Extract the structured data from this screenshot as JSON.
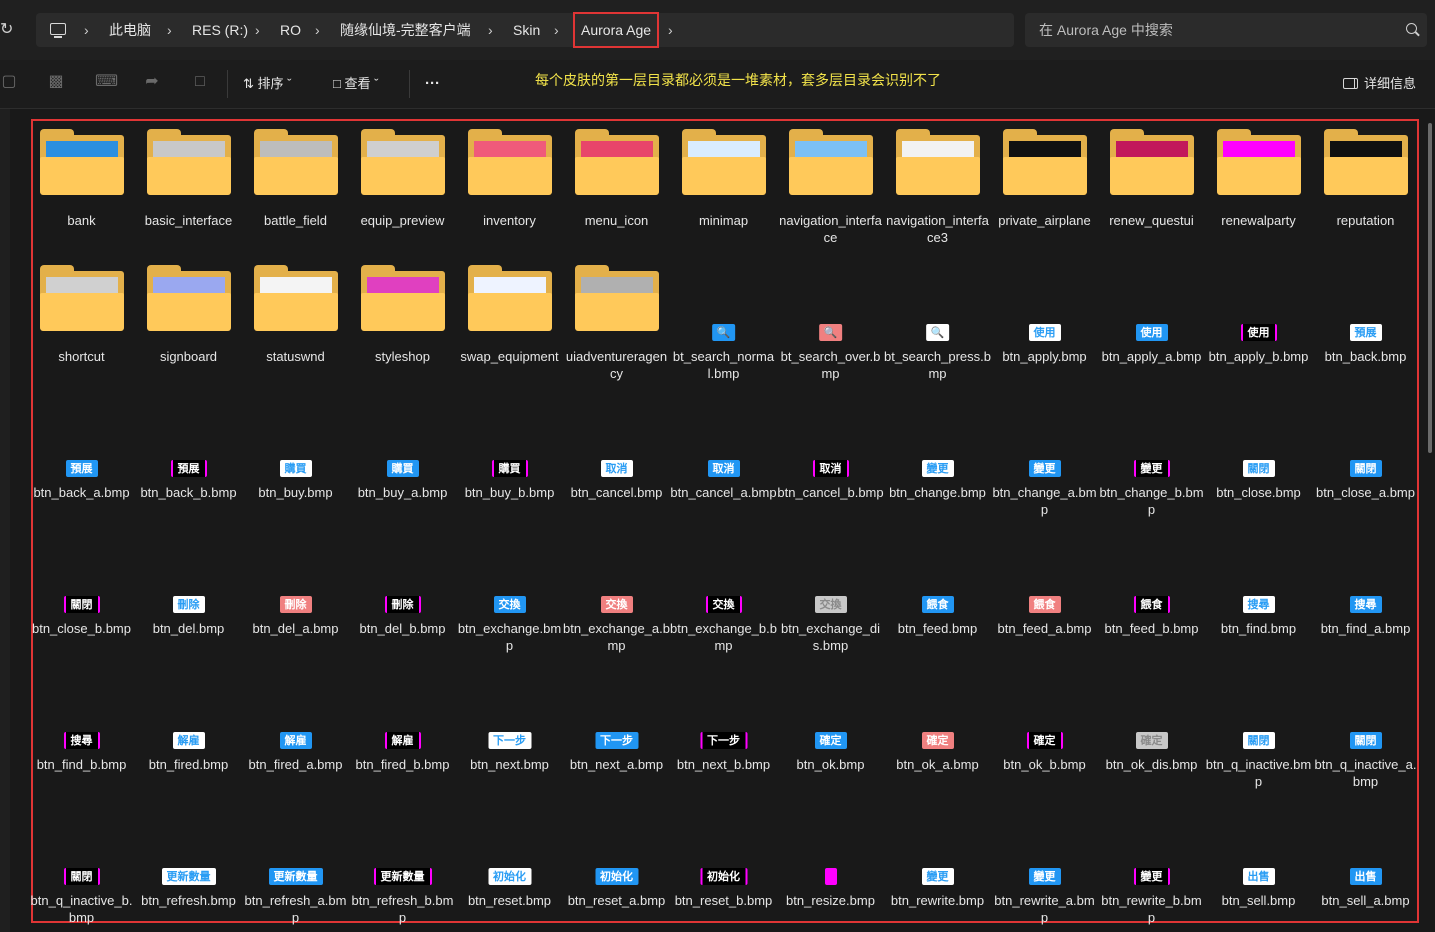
{
  "breadcrumb": {
    "items": [
      "此电脑",
      "RES (R:)",
      "RO",
      "随缘仙境-完整客户端",
      "Skin",
      "Aurora Age"
    ]
  },
  "search": {
    "placeholder": "在 Aurora Age 中搜索"
  },
  "toolbar": {
    "sort_label": "排序",
    "view_label": "查看",
    "more_label": "···",
    "notice": "每个皮肤的第一层目录都必须是一堆素材，套多层目录会识别不了",
    "details_label": "详细信息"
  },
  "files": [
    {
      "name": "bank",
      "type": "folder",
      "preview": "#2b8fe0"
    },
    {
      "name": "basic_interface",
      "type": "folder",
      "preview": "#c8c8c8"
    },
    {
      "name": "battle_field",
      "type": "folder",
      "preview": "#bdbdbd"
    },
    {
      "name": "equip_preview",
      "type": "folder",
      "preview": "#cfcfcf"
    },
    {
      "name": "inventory",
      "type": "folder",
      "preview": "#f05a7a"
    },
    {
      "name": "menu_icon",
      "type": "folder",
      "preview": "#e8456a"
    },
    {
      "name": "minimap",
      "type": "folder",
      "preview": "#d9ecff"
    },
    {
      "name": "navigation_interface",
      "type": "folder",
      "preview": "#7cc0f5"
    },
    {
      "name": "navigation_interface3",
      "type": "folder",
      "preview": "#f2f2f2"
    },
    {
      "name": "private_airplane",
      "type": "folder",
      "preview": "#111111"
    },
    {
      "name": "renew_questui",
      "type": "folder",
      "preview": "#c2185b"
    },
    {
      "name": "renewalparty",
      "type": "folder",
      "preview": "#ff00ff"
    },
    {
      "name": "reputation",
      "type": "folder",
      "preview": "#101010"
    },
    {
      "name": "shortcut",
      "type": "folder",
      "preview": "#d0d0d0"
    },
    {
      "name": "signboard",
      "type": "folder",
      "preview": "#9aa8f0"
    },
    {
      "name": "statuswnd",
      "type": "folder",
      "preview": "#f4f4f4"
    },
    {
      "name": "styleshop",
      "type": "folder",
      "preview": "#e040c0"
    },
    {
      "name": "swap_equipment",
      "type": "folder",
      "preview": "#eef3ff"
    },
    {
      "name": "uiadventureragency",
      "type": "folder",
      "preview": "#b0b0b0"
    },
    {
      "name": "bt_search_normal.bmp",
      "type": "bmp",
      "thumb": "🔍",
      "style": "st-a"
    },
    {
      "name": "bt_search_over.bmp",
      "type": "bmp",
      "thumb": "🔍",
      "style": "st-over"
    },
    {
      "name": "bt_search_press.bmp",
      "type": "bmp",
      "thumb": "🔍",
      "style": "st-n"
    },
    {
      "name": "btn_apply.bmp",
      "type": "bmp",
      "thumb": "使用",
      "style": "st-n"
    },
    {
      "name": "btn_apply_a.bmp",
      "type": "bmp",
      "thumb": "使用",
      "style": "st-a"
    },
    {
      "name": "btn_apply_b.bmp",
      "type": "bmp",
      "thumb": "使用",
      "style": "st-b"
    },
    {
      "name": "btn_back.bmp",
      "type": "bmp",
      "thumb": "預展",
      "style": "st-n"
    },
    {
      "name": "btn_back_a.bmp",
      "type": "bmp",
      "thumb": "預展",
      "style": "st-a"
    },
    {
      "name": "btn_back_b.bmp",
      "type": "bmp",
      "thumb": "預展",
      "style": "st-b"
    },
    {
      "name": "btn_buy.bmp",
      "type": "bmp",
      "thumb": "購買",
      "style": "st-n"
    },
    {
      "name": "btn_buy_a.bmp",
      "type": "bmp",
      "thumb": "購買",
      "style": "st-a"
    },
    {
      "name": "btn_buy_b.bmp",
      "type": "bmp",
      "thumb": "購買",
      "style": "st-b"
    },
    {
      "name": "btn_cancel.bmp",
      "type": "bmp",
      "thumb": "取消",
      "style": "st-n"
    },
    {
      "name": "btn_cancel_a.bmp",
      "type": "bmp",
      "thumb": "取消",
      "style": "st-a"
    },
    {
      "name": "btn_cancel_b.bmp",
      "type": "bmp",
      "thumb": "取消",
      "style": "st-b"
    },
    {
      "name": "btn_change.bmp",
      "type": "bmp",
      "thumb": "變更",
      "style": "st-n"
    },
    {
      "name": "btn_change_a.bmp",
      "type": "bmp",
      "thumb": "變更",
      "style": "st-a"
    },
    {
      "name": "btn_change_b.bmp",
      "type": "bmp",
      "thumb": "變更",
      "style": "st-b"
    },
    {
      "name": "btn_close.bmp",
      "type": "bmp",
      "thumb": "關閉",
      "style": "st-n"
    },
    {
      "name": "btn_close_a.bmp",
      "type": "bmp",
      "thumb": "關閉",
      "style": "st-a"
    },
    {
      "name": "btn_close_b.bmp",
      "type": "bmp",
      "thumb": "關閉",
      "style": "st-b"
    },
    {
      "name": "btn_del.bmp",
      "type": "bmp",
      "thumb": "刪除",
      "style": "st-n"
    },
    {
      "name": "btn_del_a.bmp",
      "type": "bmp",
      "thumb": "刪除",
      "style": "st-over"
    },
    {
      "name": "btn_del_b.bmp",
      "type": "bmp",
      "thumb": "刪除",
      "style": "st-b"
    },
    {
      "name": "btn_exchange.bmp",
      "type": "bmp",
      "thumb": "交換",
      "style": "st-a"
    },
    {
      "name": "btn_exchange_a.bmp",
      "type": "bmp",
      "thumb": "交換",
      "style": "st-over"
    },
    {
      "name": "btn_exchange_b.bmp",
      "type": "bmp",
      "thumb": "交換",
      "style": "st-b"
    },
    {
      "name": "btn_exchange_dis.bmp",
      "type": "bmp",
      "thumb": "交換",
      "style": "st-dis"
    },
    {
      "name": "btn_feed.bmp",
      "type": "bmp",
      "thumb": "餵食",
      "style": "st-a"
    },
    {
      "name": "btn_feed_a.bmp",
      "type": "bmp",
      "thumb": "餵食",
      "style": "st-over"
    },
    {
      "name": "btn_feed_b.bmp",
      "type": "bmp",
      "thumb": "餵食",
      "style": "st-b"
    },
    {
      "name": "btn_find.bmp",
      "type": "bmp",
      "thumb": "搜尋",
      "style": "st-n"
    },
    {
      "name": "btn_find_a.bmp",
      "type": "bmp",
      "thumb": "搜尋",
      "style": "st-a"
    },
    {
      "name": "btn_find_b.bmp",
      "type": "bmp",
      "thumb": "搜尋",
      "style": "st-b"
    },
    {
      "name": "btn_fired.bmp",
      "type": "bmp",
      "thumb": "解雇",
      "style": "st-n"
    },
    {
      "name": "btn_fired_a.bmp",
      "type": "bmp",
      "thumb": "解雇",
      "style": "st-a"
    },
    {
      "name": "btn_fired_b.bmp",
      "type": "bmp",
      "thumb": "解雇",
      "style": "st-b"
    },
    {
      "name": "btn_next.bmp",
      "type": "bmp",
      "thumb": "下一步",
      "style": "st-n"
    },
    {
      "name": "btn_next_a.bmp",
      "type": "bmp",
      "thumb": "下一步",
      "style": "st-a"
    },
    {
      "name": "btn_next_b.bmp",
      "type": "bmp",
      "thumb": "下一步",
      "style": "st-b"
    },
    {
      "name": "btn_ok.bmp",
      "type": "bmp",
      "thumb": "確定",
      "style": "st-a"
    },
    {
      "name": "btn_ok_a.bmp",
      "type": "bmp",
      "thumb": "確定",
      "style": "st-over"
    },
    {
      "name": "btn_ok_b.bmp",
      "type": "bmp",
      "thumb": "確定",
      "style": "st-b"
    },
    {
      "name": "btn_ok_dis.bmp",
      "type": "bmp",
      "thumb": "確定",
      "style": "st-dis"
    },
    {
      "name": "btn_q_inactive.bmp",
      "type": "bmp",
      "thumb": "關閉",
      "style": "st-n"
    },
    {
      "name": "btn_q_inactive_a.bmp",
      "type": "bmp",
      "thumb": "關閉",
      "style": "st-a"
    },
    {
      "name": "btn_q_inactive_b.bmp",
      "type": "bmp",
      "thumb": "關閉",
      "style": "st-b"
    },
    {
      "name": "btn_refresh.bmp",
      "type": "bmp",
      "thumb": "更新數量",
      "style": "st-n"
    },
    {
      "name": "btn_refresh_a.bmp",
      "type": "bmp",
      "thumb": "更新數量",
      "style": "st-a"
    },
    {
      "name": "btn_refresh_b.bmp",
      "type": "bmp",
      "thumb": "更新數量",
      "style": "st-b"
    },
    {
      "name": "btn_reset.bmp",
      "type": "bmp",
      "thumb": "初始化",
      "style": "st-n"
    },
    {
      "name": "btn_reset_a.bmp",
      "type": "bmp",
      "thumb": "初始化",
      "style": "st-a"
    },
    {
      "name": "btn_reset_b.bmp",
      "type": "bmp",
      "thumb": "初始化",
      "style": "st-b"
    },
    {
      "name": "btn_resize.bmp",
      "type": "bmp",
      "thumb": "",
      "style": "st-mag"
    },
    {
      "name": "btn_rewrite.bmp",
      "type": "bmp",
      "thumb": "變更",
      "style": "st-n"
    },
    {
      "name": "btn_rewrite_a.bmp",
      "type": "bmp",
      "thumb": "變更",
      "style": "st-a"
    },
    {
      "name": "btn_rewrite_b.bmp",
      "type": "bmp",
      "thumb": "變更",
      "style": "st-b"
    },
    {
      "name": "btn_sell.bmp",
      "type": "bmp",
      "thumb": "出售",
      "style": "st-n"
    },
    {
      "name": "btn_sell_a.bmp",
      "type": "bmp",
      "thumb": "出售",
      "style": "st-a"
    }
  ]
}
